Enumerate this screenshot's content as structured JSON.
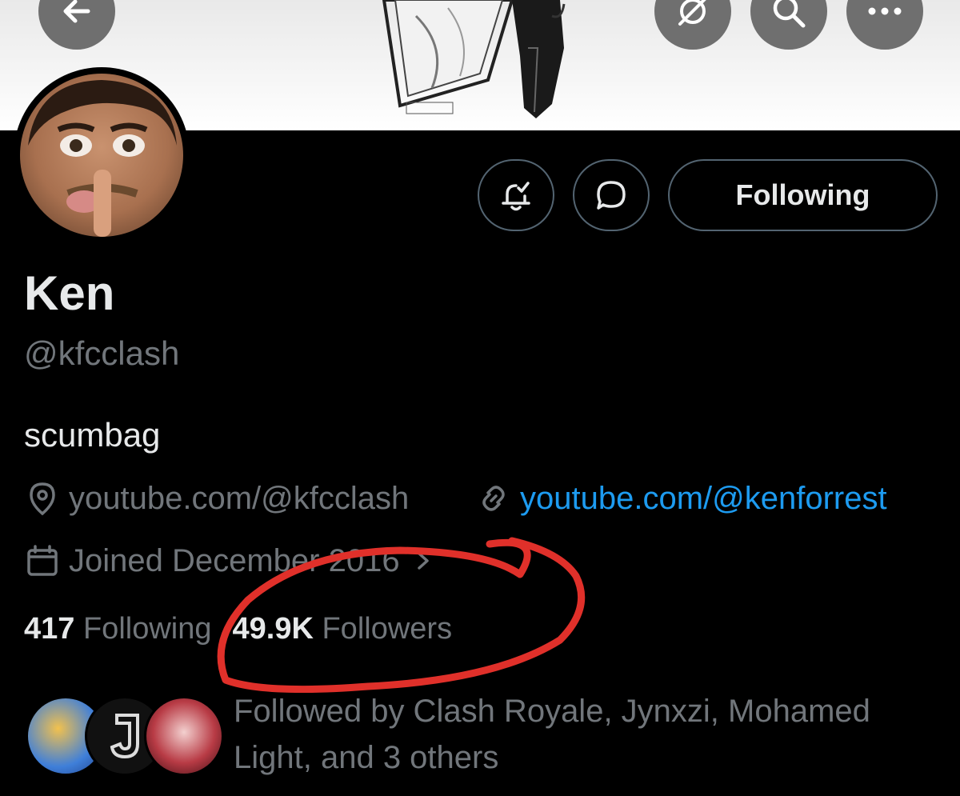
{
  "profile": {
    "name": "Ken",
    "handle": "@kfcclash",
    "bio": "scumbag",
    "location": "youtube.com/@kfcclash",
    "website": "youtube.com/@kenforrest",
    "joined": "Joined December 2016"
  },
  "actions": {
    "follow_state_label": "Following"
  },
  "stats": {
    "following_count": "417",
    "following_label": "Following",
    "followers_count": "49.9K",
    "followers_label": "Followers"
  },
  "followed_by": {
    "text": "Followed by Clash Royale, Jynxzi, Mohamed Light, and 3 others"
  },
  "header_icons": [
    "back-arrow-icon",
    "grok-icon",
    "search-icon",
    "more-icon"
  ],
  "colors": {
    "background": "#000000",
    "text_primary": "#e7e9ea",
    "text_secondary": "#71767b",
    "link": "#1d9bf0",
    "annotation": "#e0302a"
  }
}
